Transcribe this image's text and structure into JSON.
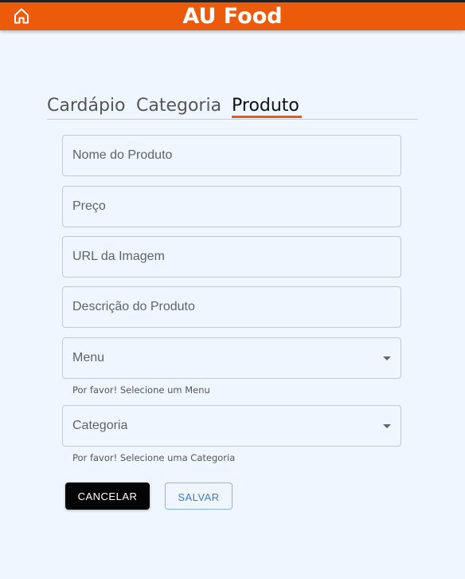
{
  "app": {
    "title": "AU Food",
    "home_icon": "home-icon"
  },
  "tabs": [
    {
      "label": "Cardápio",
      "active": false
    },
    {
      "label": "Categoria",
      "active": false
    },
    {
      "label": "Produto",
      "active": true
    }
  ],
  "form": {
    "product_name_placeholder": "Nome do Produto",
    "price_placeholder": "Preço",
    "image_url_placeholder": "URL da Imagem",
    "description_placeholder": "Descrição do Produto",
    "menu_select": {
      "label": "Menu",
      "helper": "Por favor! Selecione um Menu"
    },
    "category_select": {
      "label": "Categoria",
      "helper": "Por favor! Selecione uma Categoria"
    }
  },
  "actions": {
    "cancel_label": "CANCELAR",
    "save_label": "SALVAR"
  },
  "colors": {
    "brand": "#ec5b0a",
    "background": "#f0f6ff",
    "primary_button": "#050505",
    "outline_button": "#3a7ec6"
  }
}
